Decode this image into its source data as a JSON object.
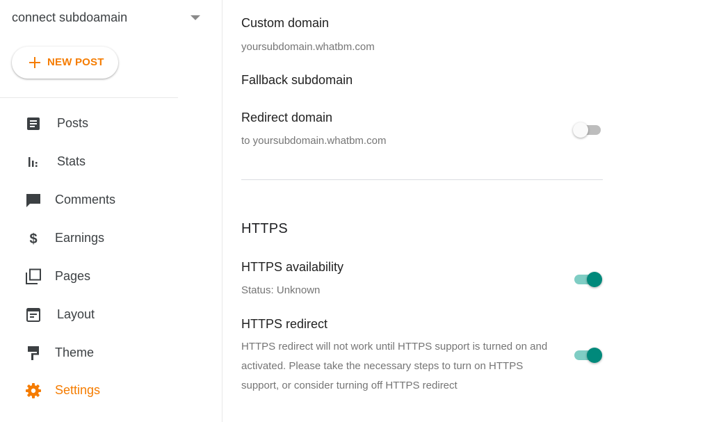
{
  "sidebar": {
    "blog_name": "connect subdoamain",
    "new_post_label": "NEW POST",
    "items": [
      {
        "label": "Posts",
        "icon": "posts-icon"
      },
      {
        "label": "Stats",
        "icon": "stats-icon"
      },
      {
        "label": "Comments",
        "icon": "comments-icon"
      },
      {
        "label": "Earnings",
        "icon": "earnings-icon"
      },
      {
        "label": "Pages",
        "icon": "pages-icon"
      },
      {
        "label": "Layout",
        "icon": "layout-icon"
      },
      {
        "label": "Theme",
        "icon": "theme-icon"
      },
      {
        "label": "Settings",
        "icon": "settings-icon",
        "active": true
      }
    ]
  },
  "settings": {
    "custom_domain": {
      "title": "Custom domain",
      "value": "yoursubdomain.whatbm.com"
    },
    "fallback_subdomain": {
      "title": "Fallback subdomain"
    },
    "redirect_domain": {
      "title": "Redirect domain",
      "subtitle": "to yoursubdomain.whatbm.com",
      "enabled": false
    },
    "https_section": {
      "title": "HTTPS",
      "availability": {
        "title": "HTTPS availability",
        "status": "Status: Unknown",
        "enabled": true
      },
      "redirect": {
        "title": "HTTPS redirect",
        "description": "HTTPS redirect will not work until HTTPS support is turned on and activated. Please take the necessary steps to turn on HTTPS support, or consider turning off HTTPS redirect",
        "enabled": true
      }
    }
  },
  "colors": {
    "accent": "#f57c00",
    "toggle_on": "#00897b",
    "toggle_on_track": "#7fcdc4",
    "toggle_off_track": "#bdbdbd",
    "icon": "#3c4043"
  }
}
